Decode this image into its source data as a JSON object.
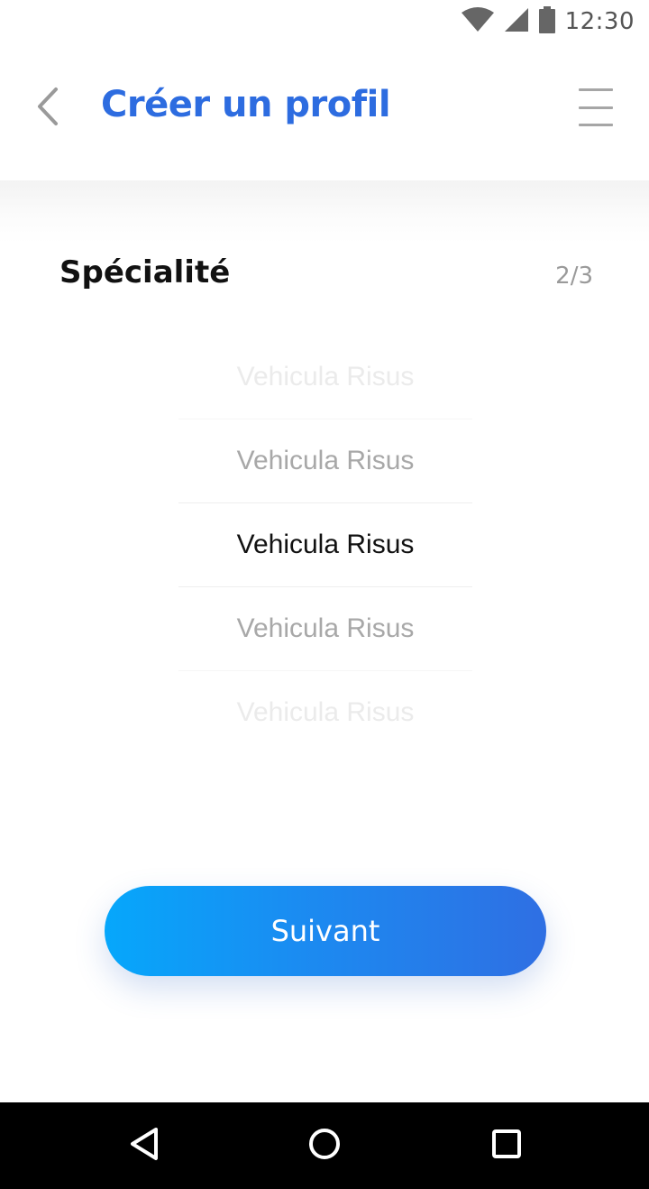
{
  "status_bar": {
    "time": "12:30",
    "icons": [
      "wifi-icon",
      "cell-signal-icon",
      "battery-icon"
    ]
  },
  "header": {
    "title": "Créer un profil",
    "back_icon": "chevron-left-icon",
    "menu_icon": "hamburger-menu-icon"
  },
  "section": {
    "title": "Spécialité",
    "step": "2/3"
  },
  "picker": {
    "items": [
      "Vehicula Risus",
      "Vehicula Risus",
      "Vehicula Risus",
      "Vehicula Risus",
      "Vehicula Risus"
    ],
    "selected_index": 2
  },
  "actions": {
    "next_label": "Suivant"
  },
  "nav_bar": {
    "icons": [
      "back-triangle-icon",
      "home-circle-icon",
      "recents-square-icon"
    ]
  },
  "colors": {
    "title_blue": "#2d6ce0",
    "button_gradient_start": "#06a7fb",
    "button_gradient_end": "#2f6fe3"
  }
}
